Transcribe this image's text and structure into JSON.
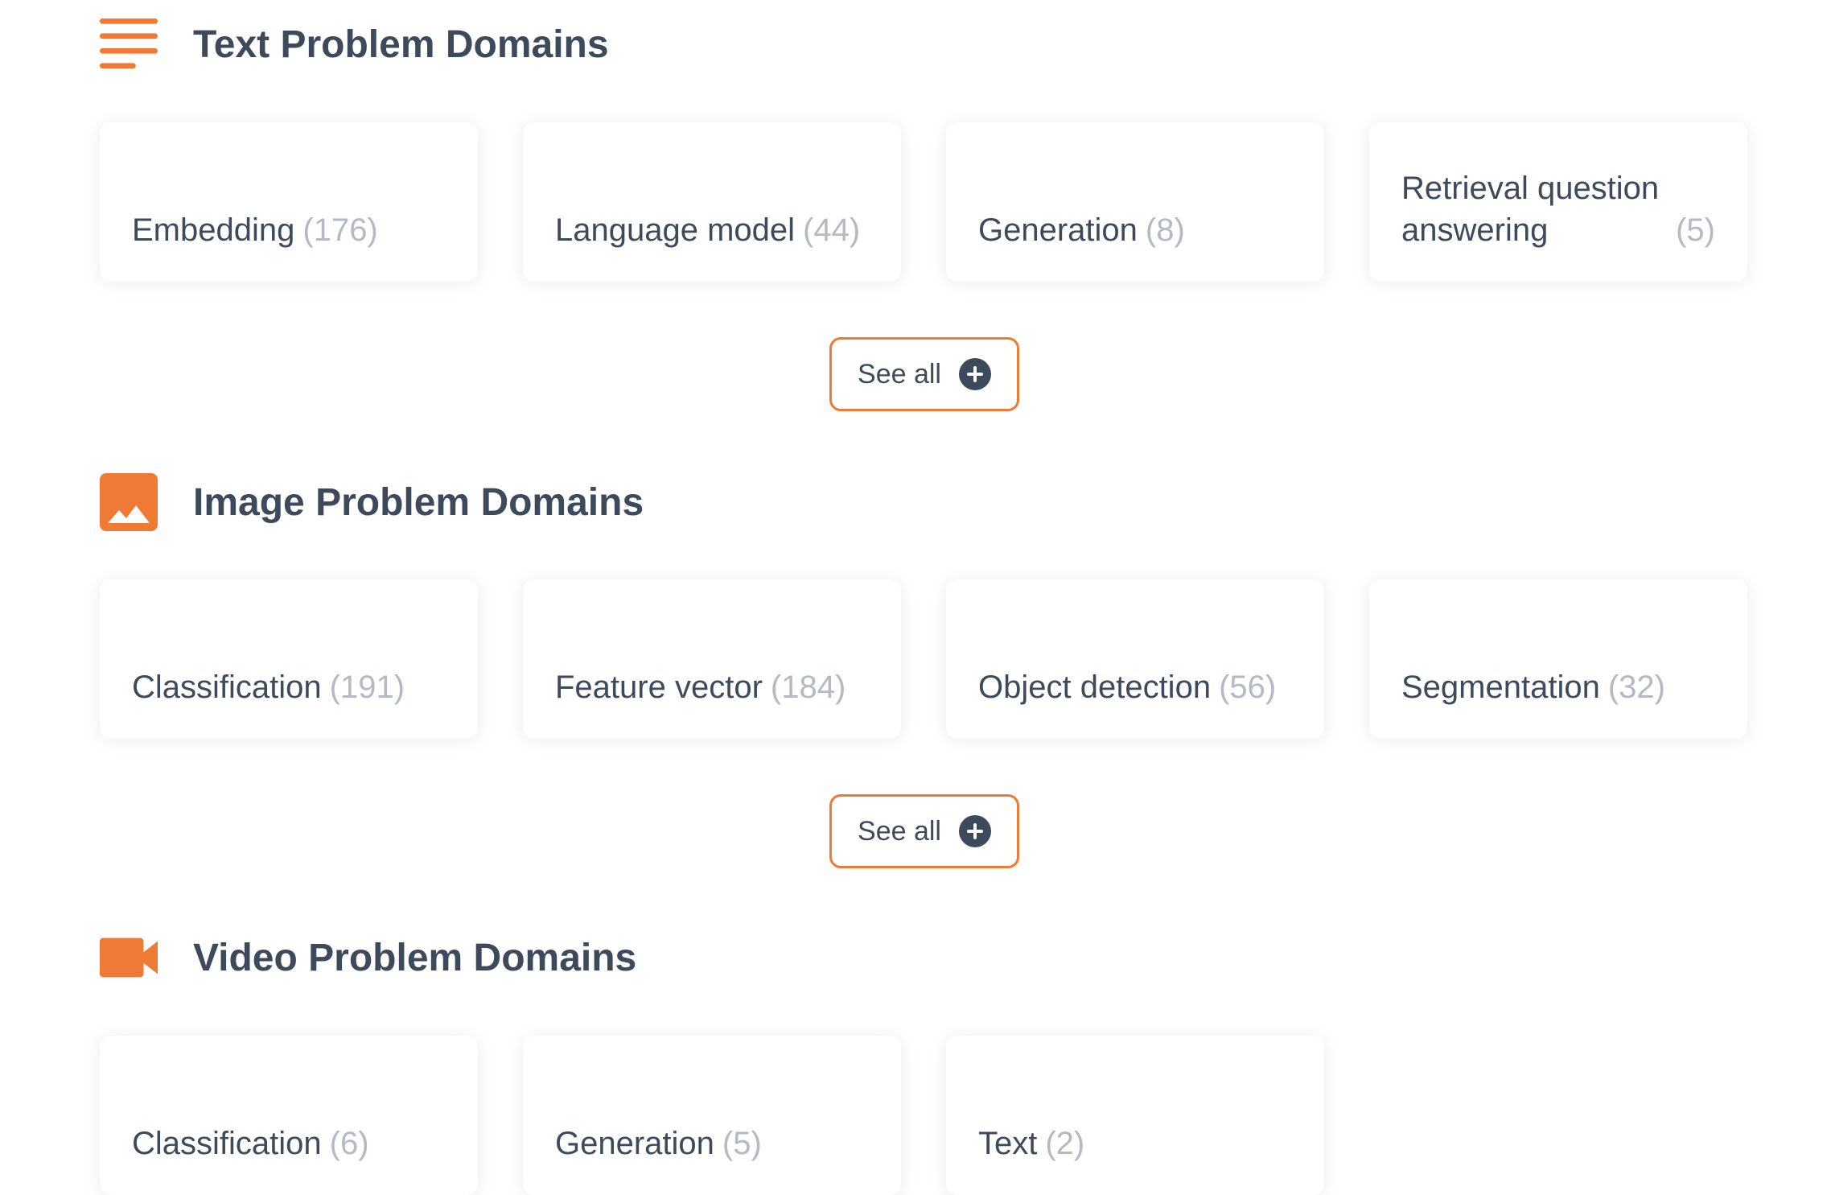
{
  "accent_color": "#ef7a35",
  "text_color": "#3d4a5c",
  "count_color": "#b4bac3",
  "sections": {
    "text": {
      "icon": "text-lines-icon",
      "title": "Text Problem Domains",
      "cards": [
        {
          "label": "Embedding",
          "count": "(176)"
        },
        {
          "label": "Language model",
          "count": "(44)"
        },
        {
          "label": "Generation",
          "count": "(8)"
        },
        {
          "label": "Retrieval question answering",
          "count": "(5)"
        }
      ],
      "see_all": "See all"
    },
    "image": {
      "icon": "image-icon",
      "title": "Image Problem Domains",
      "cards": [
        {
          "label": "Classification",
          "count": "(191)"
        },
        {
          "label": "Feature vector",
          "count": "(184)"
        },
        {
          "label": "Object detection",
          "count": "(56)"
        },
        {
          "label": "Segmentation",
          "count": "(32)"
        }
      ],
      "see_all": "See all"
    },
    "video": {
      "icon": "video-camera-icon",
      "title": "Video Problem Domains",
      "cards": [
        {
          "label": "Classification",
          "count": "(6)"
        },
        {
          "label": "Generation",
          "count": "(5)"
        },
        {
          "label": "Text",
          "count": "(2)"
        }
      ]
    }
  }
}
